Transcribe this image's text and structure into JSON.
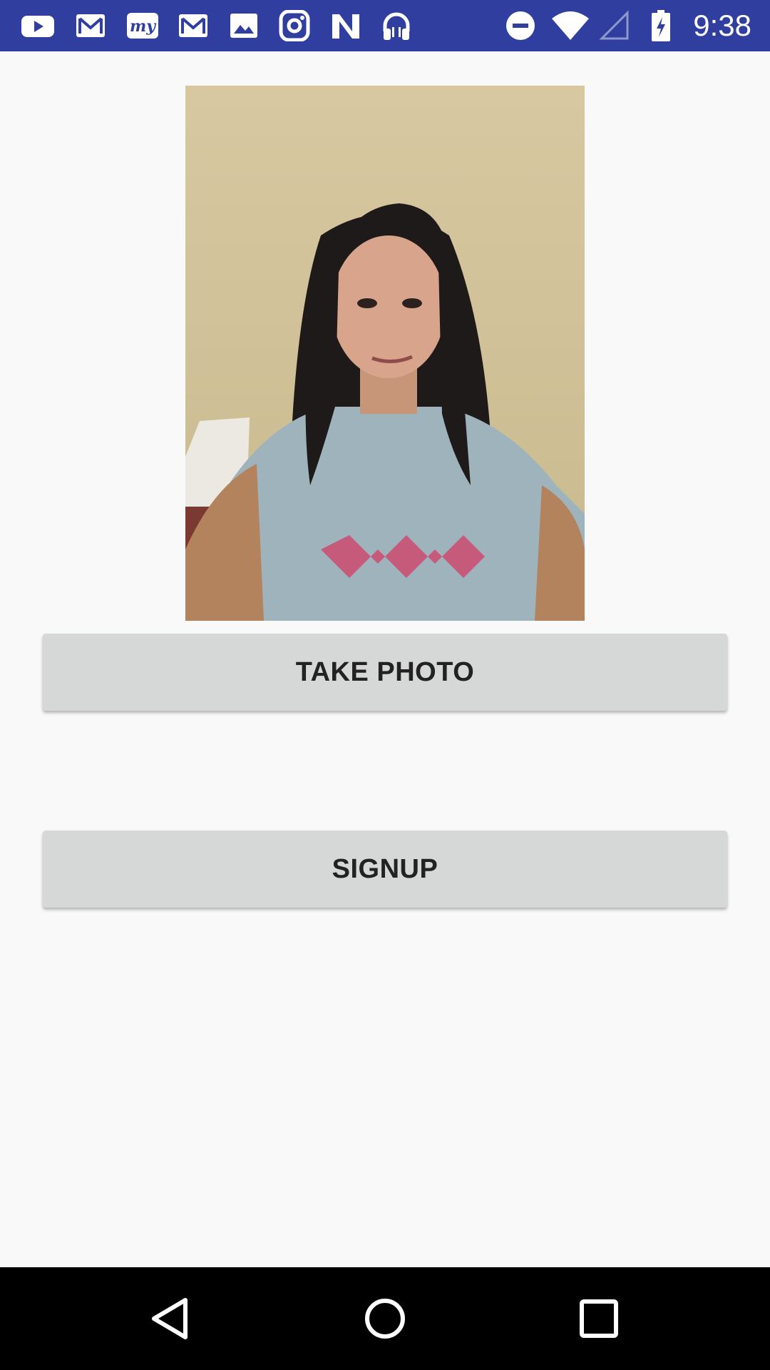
{
  "status_bar": {
    "time": "9:38",
    "left_icons": [
      "youtube-icon",
      "gmail-icon",
      "my-app-icon",
      "gmail-icon",
      "gallery-icon",
      "instagram-icon",
      "nfc-icon",
      "headphones-icon"
    ],
    "right_icons": [
      "do-not-disturb-icon",
      "wifi-icon",
      "cellular-signal-icon",
      "battery-icon"
    ]
  },
  "photo": {
    "subject": "captured-selfie-photo"
  },
  "buttons": {
    "take_photo": "TAKE PHOTO",
    "signup": "SIGNUP"
  },
  "colors": {
    "status_bar": "#303f9f",
    "background": "#f9f9f9",
    "button": "#d6d7d7",
    "nav_bar": "#000000"
  }
}
